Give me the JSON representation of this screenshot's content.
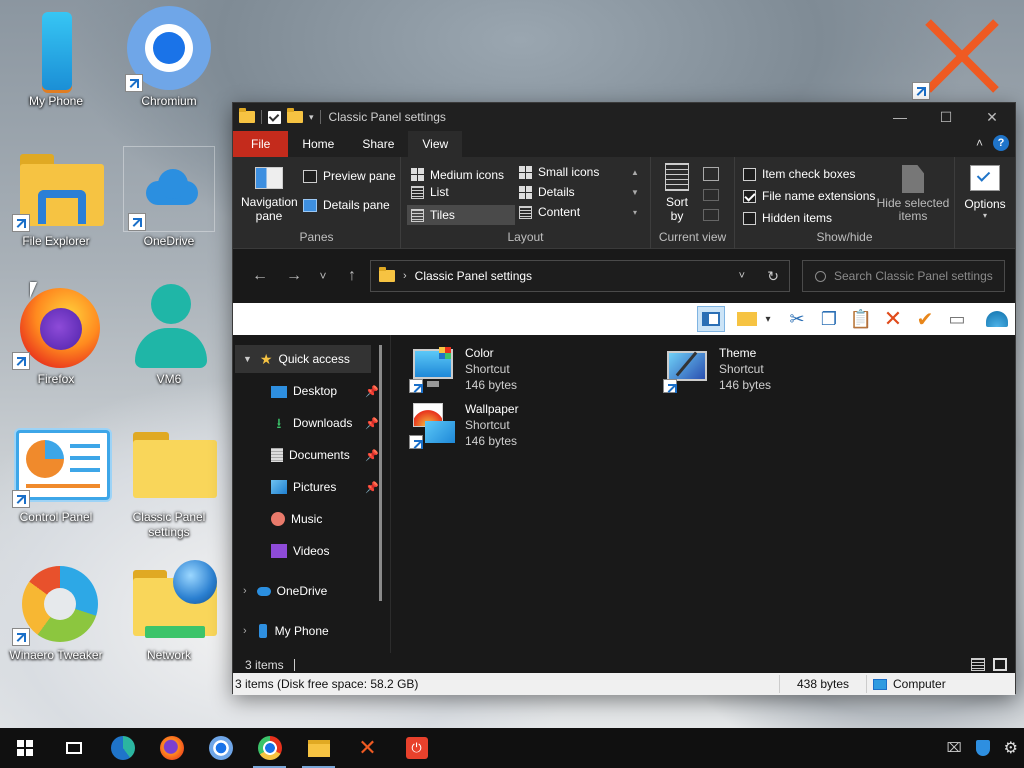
{
  "desktop": {
    "icons": [
      {
        "label": "My Phone"
      },
      {
        "label": "Chromium"
      },
      {
        "label": "File Explorer"
      },
      {
        "label": "OneDrive"
      },
      {
        "label": "Firefox"
      },
      {
        "label": "VM6"
      },
      {
        "label": "Control Panel"
      },
      {
        "label": "Classic Panel settings"
      },
      {
        "label": "Winaero Tweaker"
      },
      {
        "label": "Network"
      }
    ]
  },
  "window": {
    "title": "Classic Panel settings",
    "tabs": {
      "file": "File",
      "home": "Home",
      "share": "Share",
      "view": "View"
    },
    "ribbon": {
      "panes": {
        "group": "Panes",
        "navigation_pane": "Navigation pane",
        "preview_pane": "Preview pane",
        "details_pane": "Details pane"
      },
      "layout": {
        "group": "Layout",
        "medium_icons": "Medium icons",
        "small_icons": "Small icons",
        "list": "List",
        "details": "Details",
        "tiles": "Tiles",
        "content": "Content"
      },
      "current_view": {
        "group": "Current view",
        "sort_by": "Sort by"
      },
      "show_hide": {
        "group": "Show/hide",
        "item_check_boxes": "Item check boxes",
        "file_name_extensions": "File name extensions",
        "hidden_items": "Hidden items",
        "hide_selected_items": "Hide selected items",
        "options": "Options"
      }
    },
    "address": {
      "path": "Classic Panel settings"
    },
    "search": {
      "placeholder": "Search Classic Panel settings"
    },
    "nav": {
      "quick_access": "Quick access",
      "desktop": "Desktop",
      "downloads": "Downloads",
      "documents": "Documents",
      "pictures": "Pictures",
      "music": "Music",
      "videos": "Videos",
      "onedrive": "OneDrive",
      "my_phone": "My Phone"
    },
    "files": [
      {
        "name": "Color",
        "type": "Shortcut",
        "size": "146 bytes"
      },
      {
        "name": "Theme",
        "type": "Shortcut",
        "size": "146 bytes"
      },
      {
        "name": "Wallpaper",
        "type": "Shortcut",
        "size": "146 bytes"
      }
    ],
    "status": {
      "item_count": "3 items",
      "bottom_left": "3 items (Disk free space: 58.2 GB)",
      "bottom_size": "438 bytes",
      "bottom_location": "Computer"
    }
  },
  "colors": {
    "accent": "#c42b1c",
    "window_bg": "#191919",
    "ribbon_bg": "#2b2b2b",
    "link_blue": "#1f74c9"
  }
}
